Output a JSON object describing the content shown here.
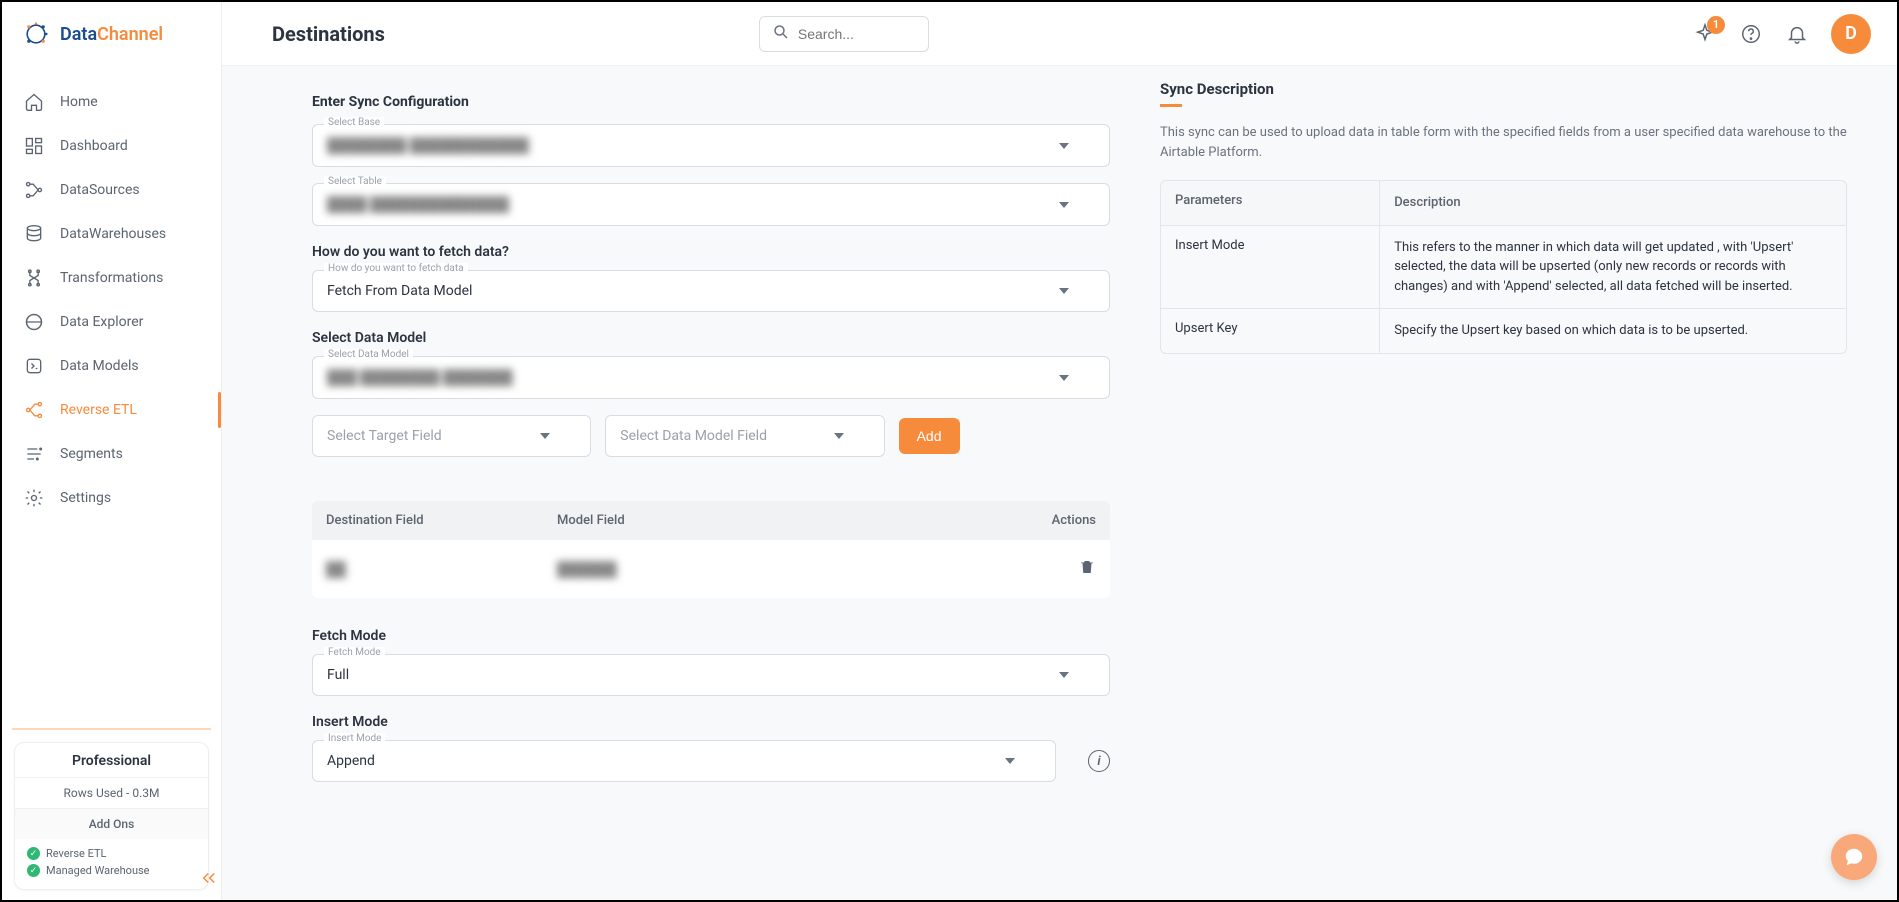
{
  "brand": {
    "primary": "Data",
    "secondary": "Channel"
  },
  "header": {
    "title": "Destinations",
    "search_placeholder": "Search...",
    "notification_count": "1",
    "avatar_letter": "D"
  },
  "sidebar": {
    "items": [
      {
        "label": "Home"
      },
      {
        "label": "Dashboard"
      },
      {
        "label": "DataSources"
      },
      {
        "label": "DataWarehouses"
      },
      {
        "label": "Transformations"
      },
      {
        "label": "Data Explorer"
      },
      {
        "label": "Data Models"
      },
      {
        "label": "Reverse ETL"
      },
      {
        "label": "Segments"
      },
      {
        "label": "Settings"
      }
    ],
    "plan": {
      "name": "Professional",
      "rows": "Rows Used - 0.3M",
      "addons_title": "Add Ons",
      "addons": [
        {
          "label": "Reverse ETL"
        },
        {
          "label": "Managed Warehouse"
        }
      ]
    }
  },
  "form": {
    "title": "Enter Sync Configuration",
    "select_base_label": "Select Base",
    "select_base_value": "████████  ████████████",
    "select_table_label": "Select Table",
    "select_table_value": "████  ██████████████",
    "fetch_question": "How do you want to fetch data?",
    "fetch_how_label": "How do you want to fetch data",
    "fetch_how_value": "Fetch From Data Model",
    "select_data_model_title": "Select Data Model",
    "select_data_model_label": "Select Data Model",
    "select_data_model_value": "███  ████████  ███████",
    "select_target_placeholder": "Select Target Field",
    "select_model_field_placeholder": "Select Data Model Field",
    "add_label": "Add",
    "mapping": {
      "col1": "Destination Field",
      "col2": "Model Field",
      "col3": "Actions",
      "row1_c1": "██",
      "row1_c2": "██████"
    },
    "fetch_mode_title": "Fetch Mode",
    "fetch_mode_label": "Fetch Mode",
    "fetch_mode_value": "Full",
    "insert_mode_title": "Insert Mode",
    "insert_mode_label": "Insert Mode",
    "insert_mode_value": "Append"
  },
  "desc": {
    "title": "Sync Description",
    "text": "This sync can be used to upload data in table form with the specified fields from a user specified data warehouse to the Airtable Platform.",
    "param_col1": "Parameters",
    "param_col2": "Description",
    "rows": [
      {
        "p": "Insert Mode",
        "d": "This refers to the manner in which data will get updated , with 'Upsert' selected, the data will be upserted (only new records or records with changes) and with 'Append' selected, all data fetched will be inserted."
      },
      {
        "p": "Upsert Key",
        "d": "Specify the Upsert key based on which data is to be upserted."
      }
    ]
  }
}
